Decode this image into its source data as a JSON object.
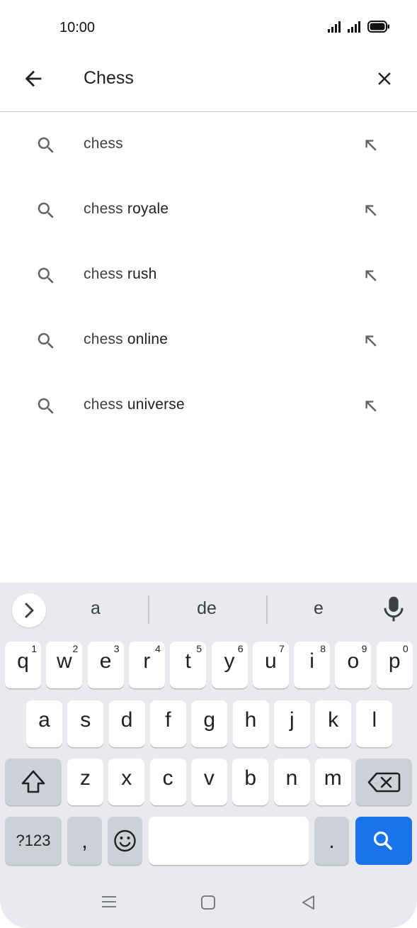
{
  "status_bar": {
    "time": "10:00",
    "icons": [
      "signal-icon",
      "signal-icon",
      "battery-icon"
    ]
  },
  "search": {
    "query": "Chess",
    "back_icon": "arrow-back-icon",
    "clear_icon": "close-icon"
  },
  "suggestions": [
    {
      "prefix": "chess",
      "suffix": ""
    },
    {
      "prefix": "chess",
      "suffix": " royale"
    },
    {
      "prefix": "chess",
      "suffix": " rush"
    },
    {
      "prefix": "chess",
      "suffix": " online"
    },
    {
      "prefix": "chess",
      "suffix": " universe"
    }
  ],
  "keyboard": {
    "word_suggestions": [
      "a",
      "de",
      "e"
    ],
    "row1": [
      [
        "q",
        "1"
      ],
      [
        "w",
        "2"
      ],
      [
        "e",
        "3"
      ],
      [
        "r",
        "4"
      ],
      [
        "t",
        "5"
      ],
      [
        "y",
        "6"
      ],
      [
        "u",
        "7"
      ],
      [
        "i",
        "8"
      ],
      [
        "o",
        "9"
      ],
      [
        "p",
        "0"
      ]
    ],
    "row2": [
      "a",
      "s",
      "d",
      "f",
      "g",
      "h",
      "j",
      "k",
      "l"
    ],
    "row3": [
      "z",
      "x",
      "c",
      "v",
      "b",
      "n",
      "m"
    ],
    "symbols_label": "?123",
    "comma_label": ",",
    "period_label": ".",
    "accent_color": "#1a73e8"
  }
}
